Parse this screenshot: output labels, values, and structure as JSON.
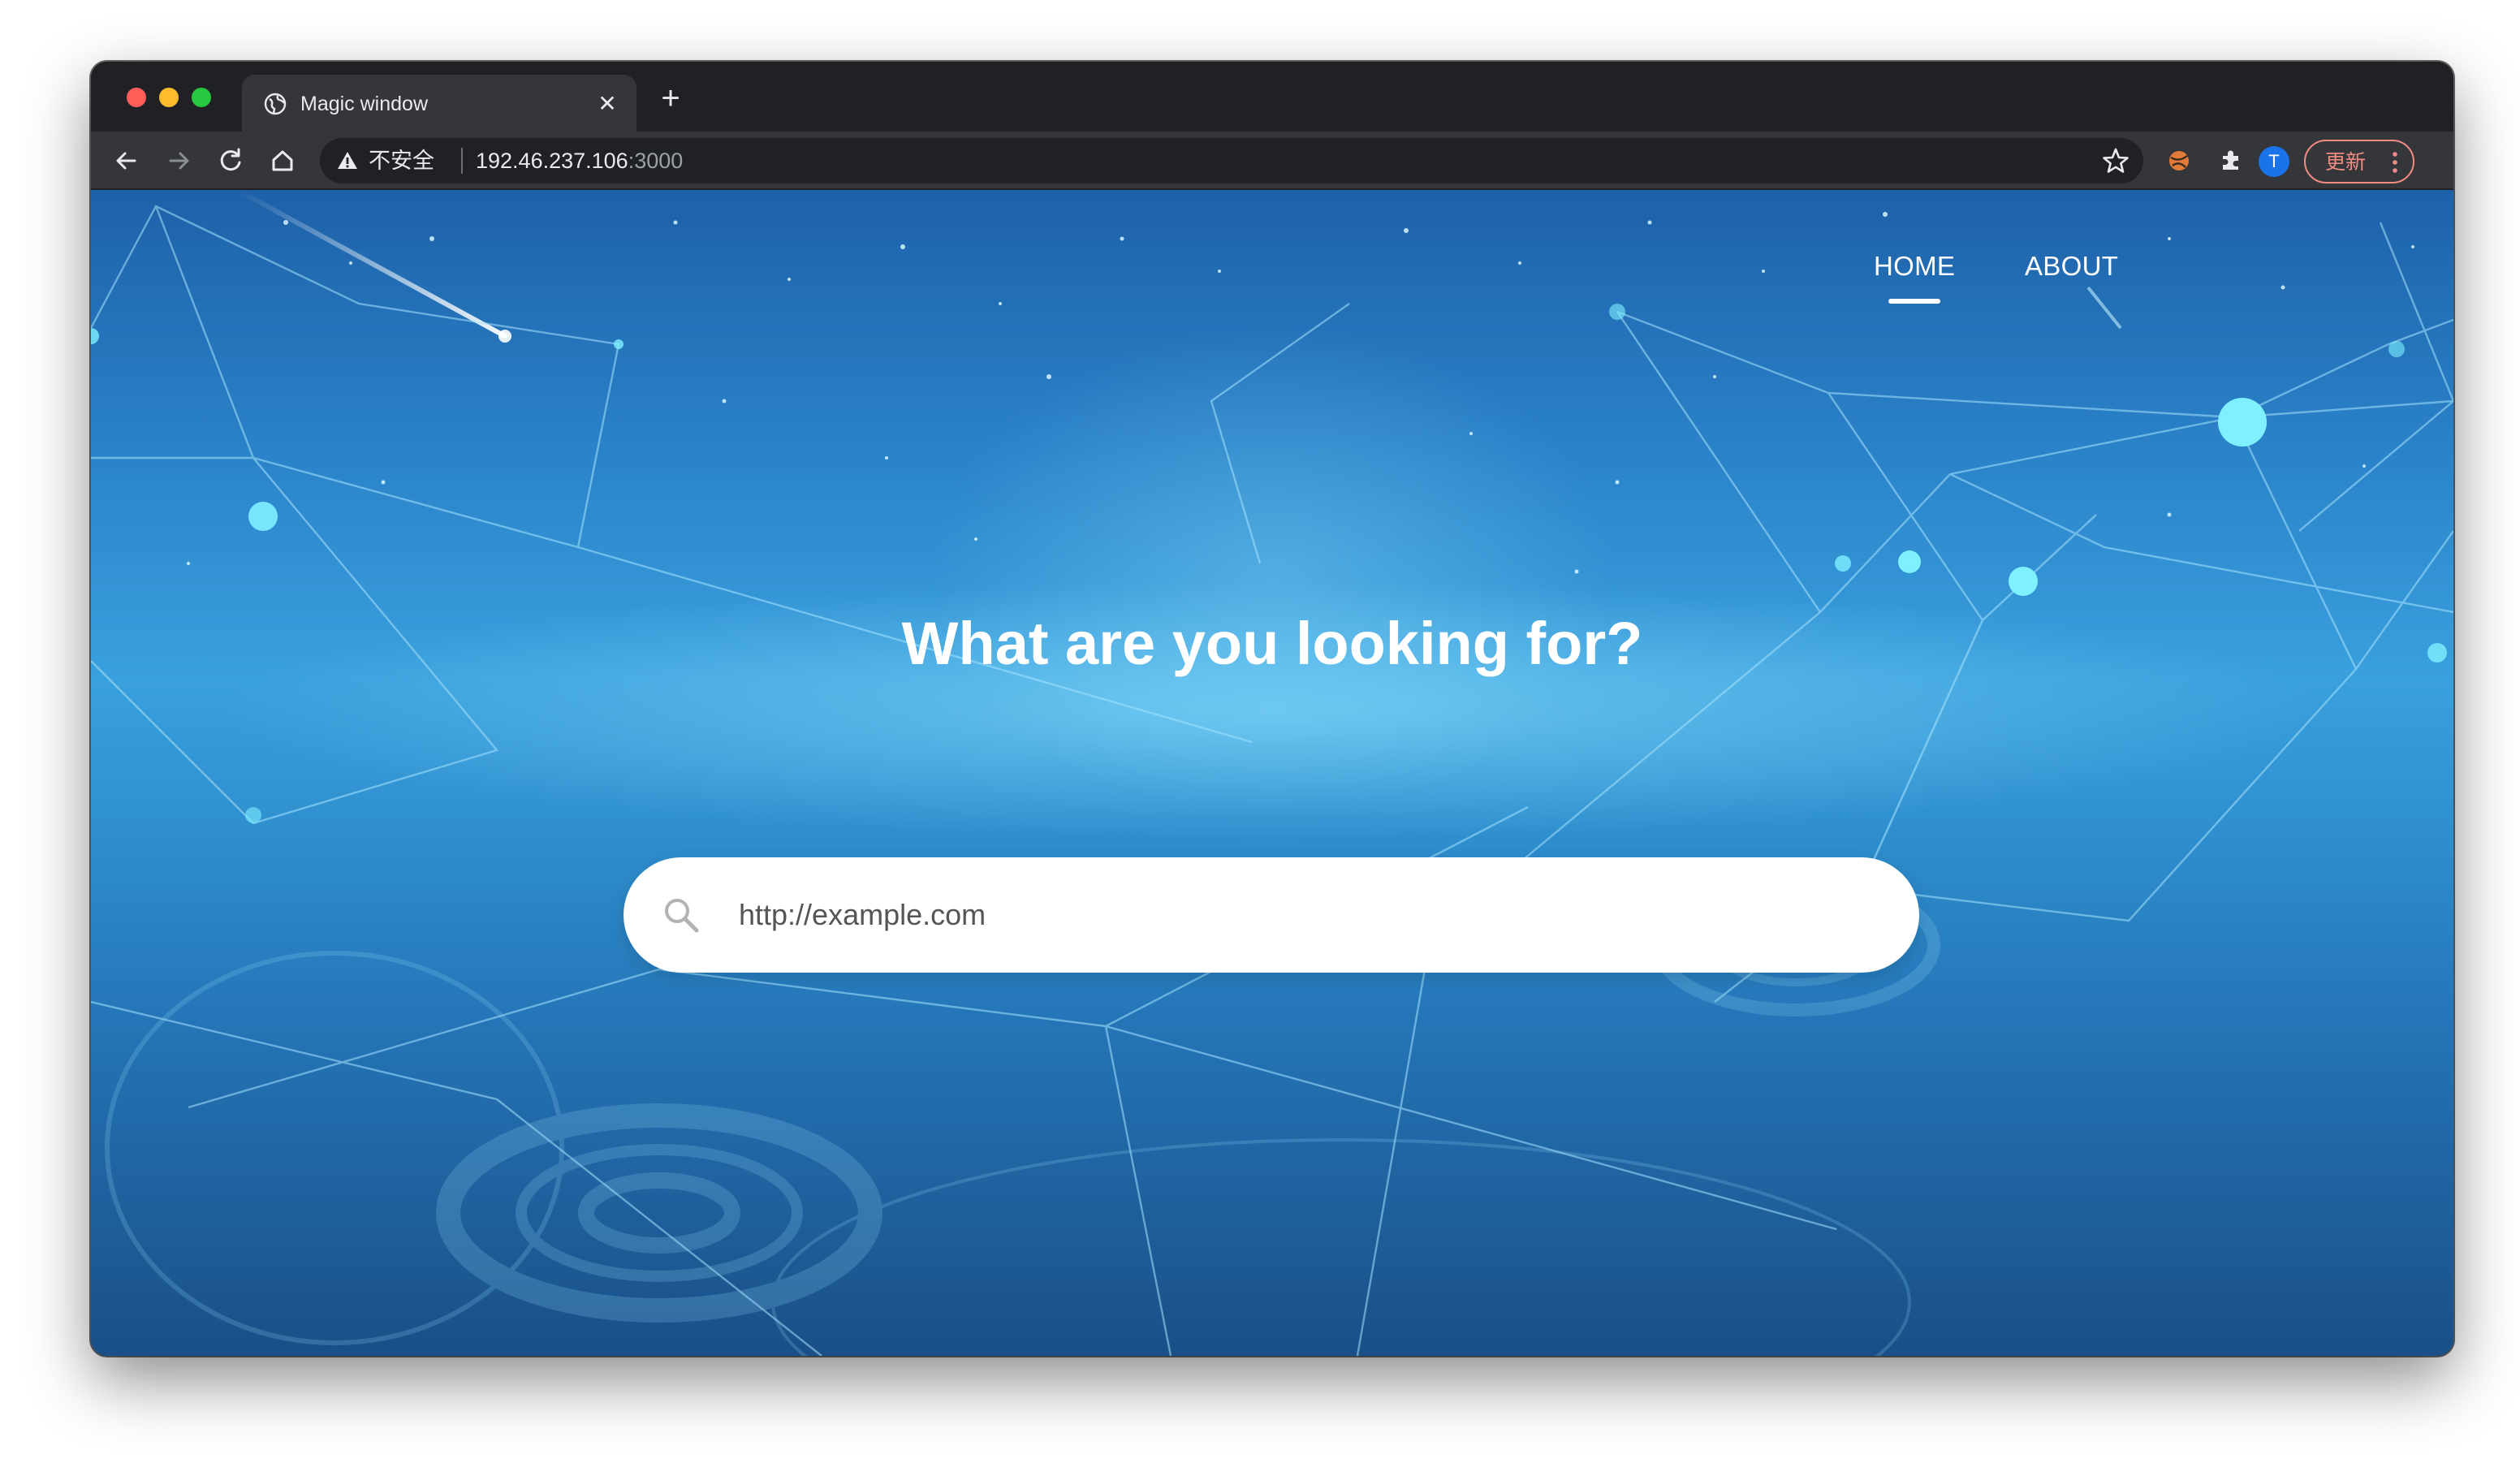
{
  "browser": {
    "tab": {
      "title": "Magic window",
      "favicon": "globe-icon"
    },
    "toolbar": {
      "security_label": "不安全",
      "url_host": "192.46.237.106",
      "url_port": ":3000",
      "avatar_letter": "T",
      "update_label": "更新"
    },
    "colors": {
      "frame": "#202124",
      "toolbar": "#35363a",
      "update_accent": "#f28b82",
      "avatar": "#1a73e8"
    }
  },
  "page": {
    "nav": {
      "items": [
        {
          "label": "HOME",
          "active": true
        },
        {
          "label": "ABOUT",
          "active": false
        }
      ]
    },
    "hero": {
      "title": "What are you looking for?"
    },
    "search": {
      "placeholder": "http://example.com",
      "value": ""
    },
    "colors": {
      "background_top": "#1e61a8",
      "background_mid": "#3aa0dd",
      "background_bottom": "#1a4f87",
      "text": "#ffffff"
    }
  }
}
